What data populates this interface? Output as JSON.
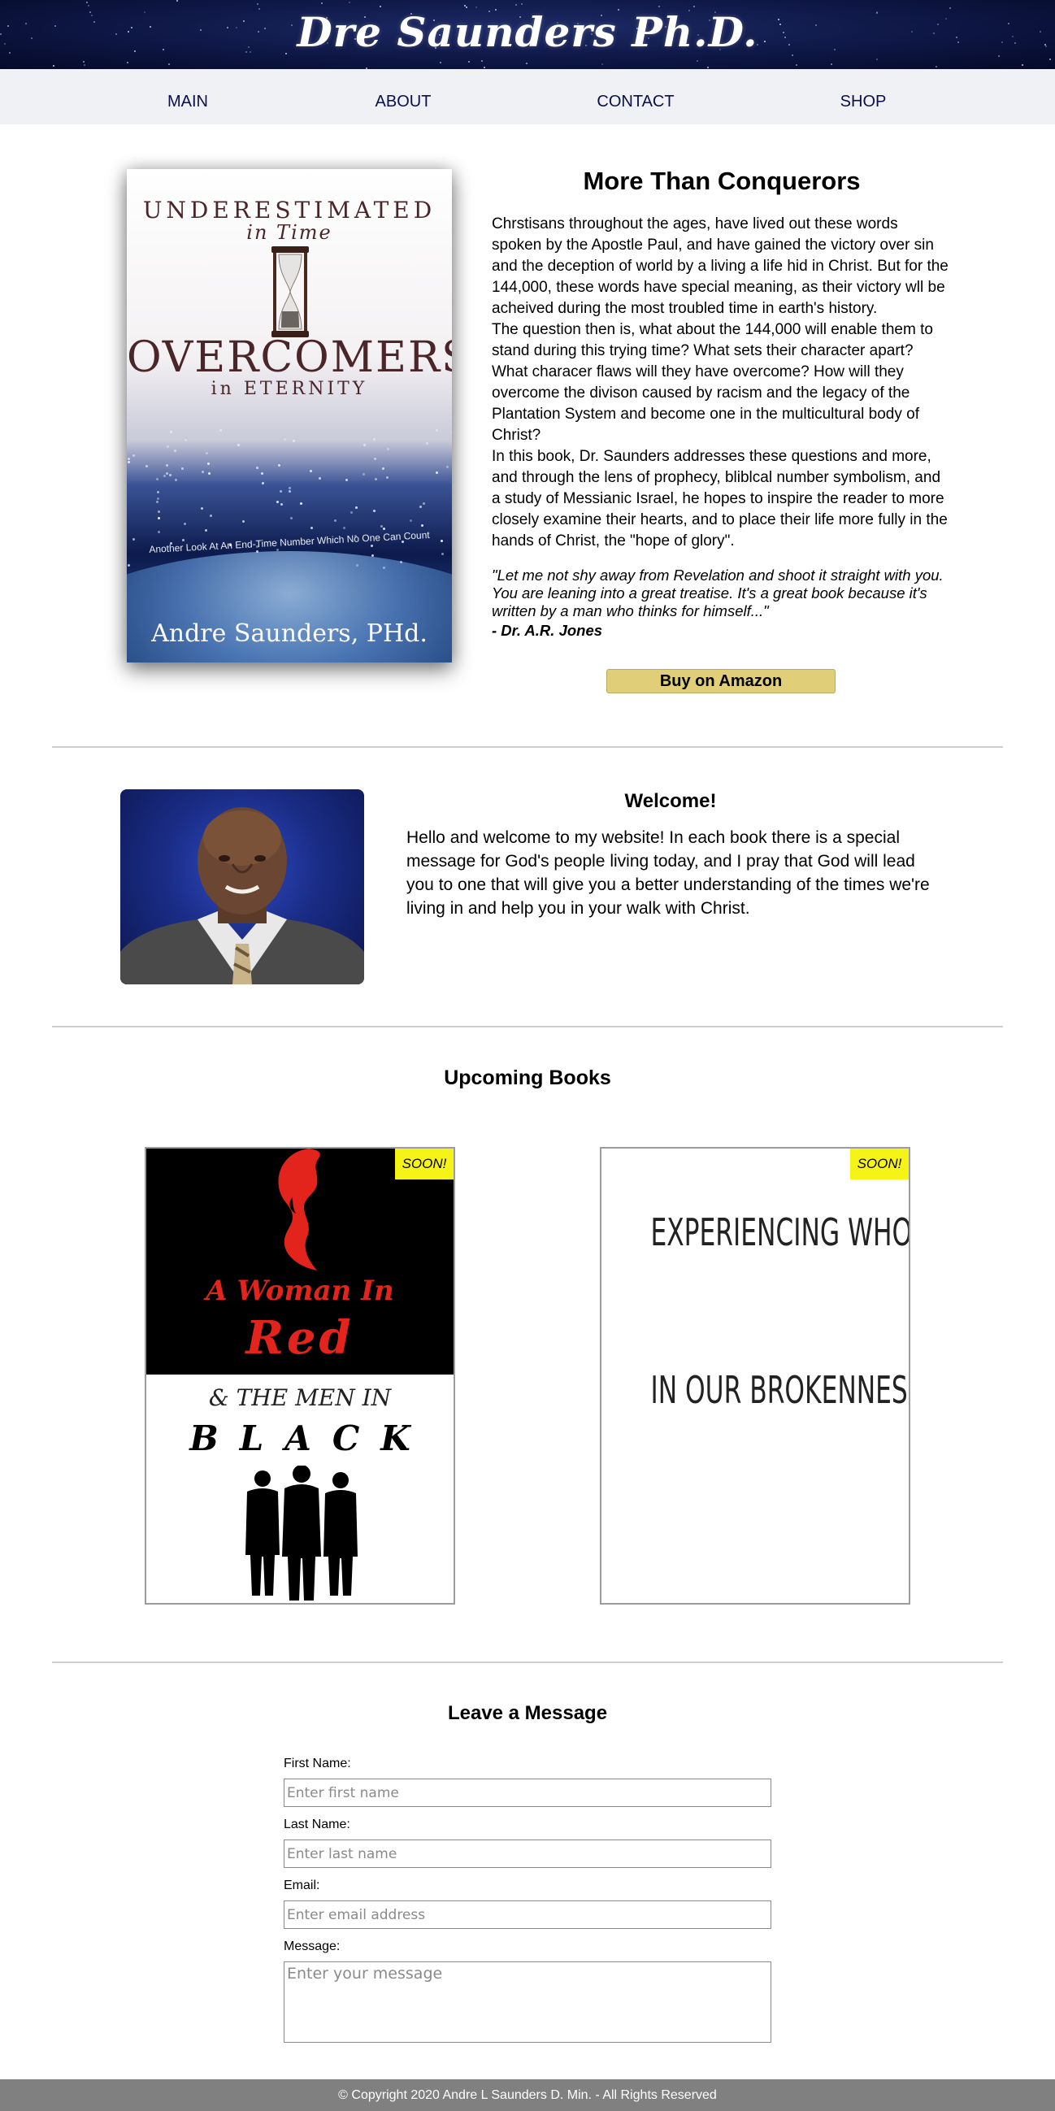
{
  "header": {
    "site_title": "Dre Saunders Ph.D."
  },
  "nav": {
    "items": [
      "MAIN",
      "ABOUT",
      "CONTACT",
      "SHOP"
    ]
  },
  "featured": {
    "title": "More Than Conquerors",
    "cover": {
      "kicker": "UNDERESTIMATED",
      "kicker2": "in Time",
      "main_title": "OVERCOMERS",
      "subtitle": "in ETERNITY",
      "tagline": "Another Look At An End-Time Number Which No One Can Count",
      "author": "Andre Saunders, PHd."
    },
    "description": [
      "Chrstisans throughout the ages, have lived out these words spoken by the Apostle Paul, and have gained the victory over sin and the deception of world by a living a life hid in Christ. But for the 144,000, these words have special meaning, as their victory wll be acheived during the most troubled time in earth's history.",
      "The question then is, what about the 144,000 will enable them to stand during this trying time? What sets their character apart? What characer flaws will they have overcome? How will they overcome the divison caused by racism and the legacy of the Plantation System and become one in the multicultural body of Christ?",
      "In this book, Dr. Saunders addresses these questions and more, and through the lens of prophecy, bliblcal number symbolism, and a study of Messianic Israel, he hopes to inspire the reader to more closely examine their hearts, and to place their life more fully in the hands of Christ, the \"hope of glory\"."
    ],
    "quote": "\"Let me not shy away from Revelation and shoot it straight with you. You are leaning into a great treatise. It's a great book because it's written by a man who thinks for himself...\"",
    "quote_author": "- Dr. A.R. Jones",
    "buy_label": "Buy on Amazon"
  },
  "welcome": {
    "title": "Welcome!",
    "text": "Hello and welcome to my website! In each book there is a special message for God's people living today, and I pray that God will lead you to one that will give you a better understanding of the times we're living in and help you in your walk with Christ."
  },
  "upcoming": {
    "title": "Upcoming Books",
    "books": [
      {
        "badge": "SOON!",
        "cover_line1": "A Woman In",
        "cover_line2": "Red",
        "cover_line3": "& THE MEN IN",
        "cover_line4": "BLACK"
      },
      {
        "badge": "SOON!",
        "cover_line1": "EXPERIENCING WHOLENESS",
        "cover_line2": "IN OUR BROKENNESS"
      }
    ]
  },
  "contact": {
    "title": "Leave a Message",
    "first_name": {
      "label": "First Name:",
      "placeholder": "Enter first name"
    },
    "last_name": {
      "label": "Last Name:",
      "placeholder": "Enter last name"
    },
    "email": {
      "label": "Email:",
      "placeholder": "Enter email address"
    },
    "message": {
      "label": "Message:",
      "placeholder": "Enter your message"
    }
  },
  "footer": {
    "copyright": "© Copyright 2020 Andre L Saunders D. Min. - All Rights Reserved"
  },
  "colors": {
    "header_bg": "#0e1745",
    "nav_bg": "#eff1f5",
    "nav_text": "#0b0f4a",
    "buy_button": "#e0cf78",
    "soon_badge": "#f6f417",
    "footer_bg": "#808080"
  }
}
